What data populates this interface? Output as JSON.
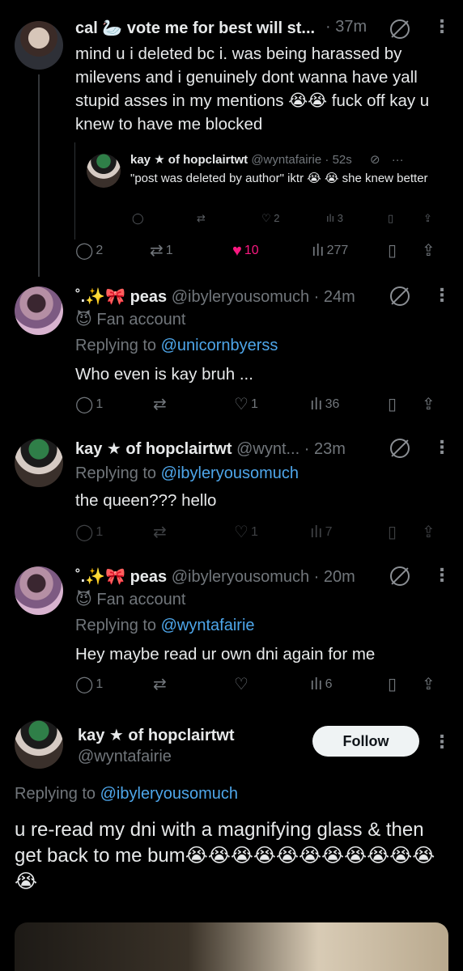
{
  "tweets": {
    "t1": {
      "name": "cal 🦢 vote me for best will st...",
      "time": "· 37m",
      "text": "mind u i deleted bc i. was being harassed by milevens and i genuinely dont wanna have yall stupid asses in my mentions 😭😭 fuck off kay u knew to have me blocked",
      "quote": {
        "name": "kay ★ of hopclairtwt",
        "handle": "@wyntafairie · 52s",
        "text": "\"post was deleted by author\" iktr 😭 😭 she knew better",
        "likes": "2",
        "views": "3"
      },
      "replies": "2",
      "reposts": "1",
      "likes": "10",
      "views": "277"
    },
    "t2": {
      "name": "˚.✨🎀 peas",
      "handle": "@ibyleryousomuch · 24m",
      "fan": "Fan account",
      "replying_prefix": "Replying to",
      "replying_to": "@unicornbyerss",
      "text": "Who even is kay bruh ...",
      "replies": "1",
      "likes": "1",
      "views": "36"
    },
    "t3": {
      "name": "kay ★ of hopclairtwt",
      "handle": "@wynt... · 23m",
      "replying_prefix": "Replying to",
      "replying_to": "@ibyleryousomuch",
      "text": "the queen??? hello",
      "replies": "1",
      "likes": "1",
      "views": "7"
    },
    "t4": {
      "name": "˚.✨🎀 peas",
      "handle": "@ibyleryousomuch · 20m",
      "fan": "Fan account",
      "replying_prefix": "Replying to",
      "replying_to": "@wyntafairie",
      "text": "Hey maybe read ur own dni again for me",
      "replies": "1",
      "views": "6"
    },
    "t5": {
      "name": "kay ★ of hopclairtwt",
      "handle": "@wyntafairie",
      "follow_label": "Follow",
      "replying_prefix": "Replying to",
      "replying_to": "@ibyleryousomuch",
      "text": "u re-read my dni with a magnifying glass & then get back to me bum😭😭😭😭😭😭😭😭😭😭😭😭"
    }
  },
  "icons": {
    "reply": "reply-icon",
    "repost": "repost-icon",
    "like": "heart-icon",
    "views": "views-icon",
    "bookmark": "bookmark-icon",
    "share": "share-icon",
    "grok": "grok-icon",
    "more": "more-icon"
  },
  "colors": {
    "background": "#000000",
    "text": "#e7e9ea",
    "muted": "#71767b",
    "link": "#4ea6ea",
    "like_active": "#f91880"
  }
}
